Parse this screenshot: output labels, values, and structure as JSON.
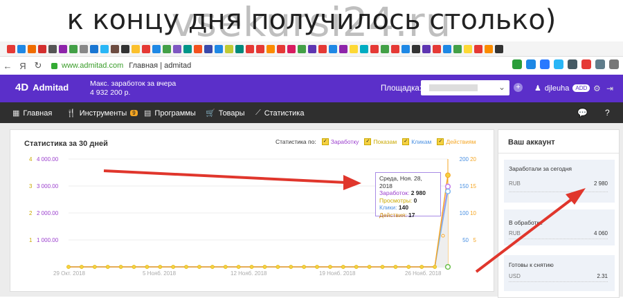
{
  "overlay": {
    "caption": "к концу дня получилось столько)",
    "watermark": "vsekursi24.ru"
  },
  "browser": {
    "url": "www.admitad.com",
    "tab_title": "Главная | admitad",
    "yandex": "Я"
  },
  "header": {
    "brand": "Admitad",
    "earnings_label": "Макс. заработок за вчера",
    "earnings_value": "4 932 200 р.",
    "platform_label": "Площадка:",
    "username": "djleuha",
    "user_badge": "ADD"
  },
  "menu": {
    "items": [
      {
        "label": "Главная",
        "icon": "grid-icon"
      },
      {
        "label": "Инструменты",
        "icon": "tools-icon",
        "count": "9"
      },
      {
        "label": "Программы",
        "icon": "document-icon"
      },
      {
        "label": "Товары",
        "icon": "cart-icon"
      },
      {
        "label": "Статистика",
        "icon": "chart-line-icon"
      }
    ]
  },
  "stats": {
    "title": "Статистика за 30 дней",
    "legend_label": "Статистика по:",
    "legend": [
      {
        "label": "Заработку",
        "color": "#9a3dcd"
      },
      {
        "label": "Показам",
        "color": "#c9a800"
      },
      {
        "label": "Кликам",
        "color": "#4a90e2"
      },
      {
        "label": "Действиям",
        "color": "#f5a623"
      }
    ]
  },
  "chart_data": {
    "type": "line",
    "x_labels": [
      "29 Окт. 2018",
      "5 Нояб. 2018",
      "12 Нояб. 2018",
      "19 Нояб. 2018",
      "26 Нояб. 2018"
    ],
    "y_left_inner": [
      "4",
      "3",
      "2",
      "1"
    ],
    "y_left": [
      "4 000.00",
      "3 000.00",
      "2 000.00",
      "1 000.00"
    ],
    "y_right_outer": [
      "200",
      "150",
      "100",
      "50"
    ],
    "y_right_inner": [
      "20",
      "15",
      "10",
      "5"
    ],
    "series": [
      {
        "name": "Заработку",
        "color": "#c47ce8",
        "final": 2980,
        "prev": 0
      },
      {
        "name": "Показам",
        "color": "#f5d142",
        "final": 0,
        "prev": 0
      },
      {
        "name": "Кликам",
        "color": "#7db7f0",
        "final": 140,
        "prev": 0
      },
      {
        "name": "Действиям",
        "color": "#f5a623",
        "final": 17,
        "prev": 0
      }
    ],
    "tooltip": {
      "date": "Среда, Ноя. 28, 2018",
      "earnings_label": "Заработок:",
      "earnings": "2 980",
      "views_label": "Просмотры:",
      "views": "0",
      "clicks_label": "Клики:",
      "clicks": "140",
      "actions_label": "Действия:",
      "actions": "17"
    }
  },
  "account": {
    "title": "Ваш аккаунт",
    "today_label": "Заработали за сегодня",
    "today_currency": "RUB",
    "today_value": "2 980",
    "processing_label": "В обработке",
    "processing_currency": "RUB",
    "processing_value": "4 060",
    "withdraw_label": "Готовы к снятию",
    "withdraw_currency": "USD",
    "withdraw_value": "2.31"
  },
  "colors": {
    "brand": "#5b2fc9",
    "menubar": "#2f2f2f",
    "arrow": "#e0362c"
  }
}
